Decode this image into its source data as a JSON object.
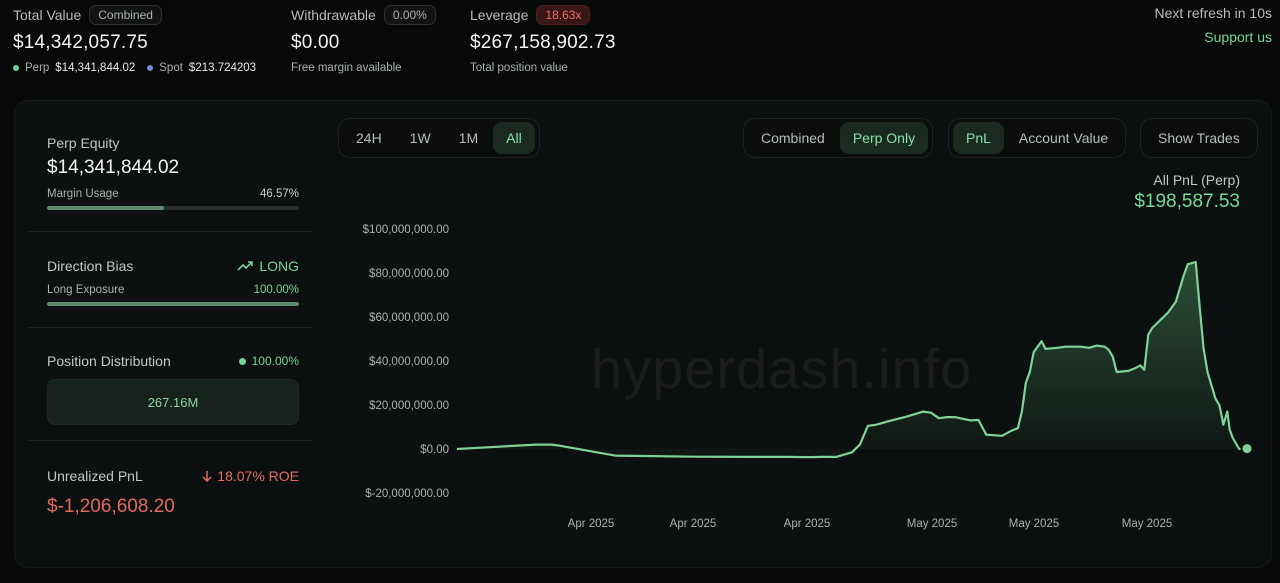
{
  "header": {
    "total_value": {
      "label": "Total Value",
      "chip": "Combined",
      "value": "$14,342,057.75",
      "perp_label": "Perp",
      "perp_value": "$14,341,844.02",
      "spot_label": "Spot",
      "spot_value": "$213.724203"
    },
    "withdrawable": {
      "label": "Withdrawable",
      "chip": "0.00%",
      "value": "$0.00",
      "sub": "Free margin available"
    },
    "leverage": {
      "label": "Leverage",
      "chip": "18.63x",
      "value": "$267,158,902.73",
      "sub": "Total position value"
    },
    "refresh_text": "Next refresh in 10s",
    "support_label": "Support us"
  },
  "colors": {
    "accent": "#76d497",
    "negative": "#e06a60",
    "perp_dot": "#6fcf97",
    "spot_dot": "#6b8fd6"
  },
  "left_panel": {
    "perp_equity": {
      "label": "Perp Equity",
      "value": "$14,341,844.02",
      "margin_label": "Margin Usage",
      "margin_value": "46.57%",
      "margin_fraction": 0.4657
    },
    "direction": {
      "label": "Direction Bias",
      "icon": "trending-up-icon",
      "value": "LONG",
      "exposure_label": "Long Exposure",
      "exposure_value": "100.00%",
      "exposure_fraction": 1.0
    },
    "distribution": {
      "label": "Position Distribution",
      "value": "100.00%",
      "box_value": "267.16M"
    },
    "unrealized": {
      "label": "Unrealized PnL",
      "icon": "arrow-down-icon",
      "roe": "18.07% ROE",
      "value": "$-1,206,608.20"
    }
  },
  "controls": {
    "timeframes": [
      "24H",
      "1W",
      "1M",
      "All"
    ],
    "timeframe_active": 3,
    "modes": [
      "Combined",
      "Perp Only"
    ],
    "mode_active": 1,
    "metrics": [
      "PnL",
      "Account Value"
    ],
    "metric_active": 0,
    "show_trades_label": "Show Trades"
  },
  "chart_summary": {
    "title": "All PnL (Perp)",
    "value": "$198,587.53",
    "watermark": "hyperdash.info"
  },
  "chart_data": {
    "type": "area",
    "title": "",
    "xlabel": "",
    "ylabel": "",
    "ylim": [
      -20000000,
      100000000
    ],
    "yticks": [
      "$100,000,000.00",
      "$80,000,000.00",
      "$60,000,000.00",
      "$40,000,000.00",
      "$20,000,000.00",
      "$0.00",
      "$-20,000,000.00"
    ],
    "ytick_values": [
      100000000,
      80000000,
      60000000,
      40000000,
      20000000,
      0,
      -20000000
    ],
    "xticks": [
      "Apr 2025",
      "Apr 2025",
      "Apr 2025",
      "May 2025",
      "May 2025",
      "May 2025"
    ],
    "grid": false,
    "legend": "none",
    "series": [
      {
        "values": [
          0,
          1000000,
          2000000,
          2000000,
          1500000,
          -3000000,
          -3500000,
          -3600000,
          -3600000,
          -3700000,
          -3700000,
          -3600000,
          -3600000,
          -3600000,
          -1500000,
          2000000,
          10500000,
          11000000,
          13000000,
          14800000,
          17000000,
          16500000,
          14000000,
          14500000,
          14500000,
          13000000,
          13200000,
          6500000,
          6000000,
          8000000,
          9500000,
          17000000,
          30000000,
          35000000,
          44000000,
          49000000,
          45500000,
          46000000,
          46500000,
          46500000,
          46000000,
          47000000,
          46500000,
          45000000,
          42000000,
          35000000,
          35500000,
          37000000,
          38000000,
          36000000,
          52000000,
          55000000,
          62000000,
          67000000,
          79000000,
          84000000,
          85000000,
          65000000,
          46000000,
          35000000,
          23000000,
          20000000,
          15000000,
          11000000,
          17000000,
          9000000,
          5000000,
          0,
          198587.53
        ]
      }
    ]
  }
}
